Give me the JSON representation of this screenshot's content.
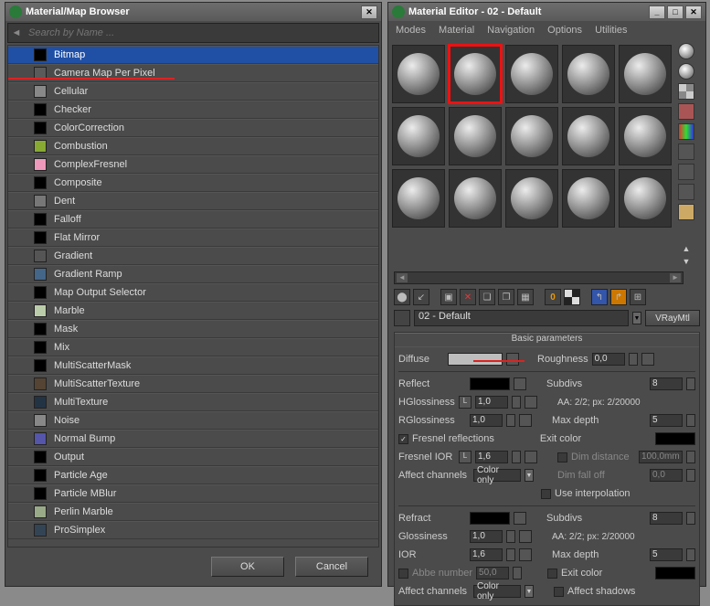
{
  "browser": {
    "title": "Material/Map Browser",
    "search_placeholder": "Search by Name ...",
    "ok": "OK",
    "cancel": "Cancel",
    "maps": [
      {
        "label": "Bitmap",
        "color": "#000",
        "sel": true
      },
      {
        "label": "Camera Map Per Pixel",
        "color": "#5a5a5a"
      },
      {
        "label": "Cellular",
        "color": "#888"
      },
      {
        "label": "Checker",
        "color": "#000"
      },
      {
        "label": "ColorCorrection",
        "color": "#000"
      },
      {
        "label": "Combustion",
        "color": "#8a3"
      },
      {
        "label": "ComplexFresnel",
        "color": "#e9b"
      },
      {
        "label": "Composite",
        "color": "#000"
      },
      {
        "label": "Dent",
        "color": "#777"
      },
      {
        "label": "Falloff",
        "color": "#000"
      },
      {
        "label": "Flat Mirror",
        "color": "#000"
      },
      {
        "label": "Gradient",
        "color": "#555"
      },
      {
        "label": "Gradient Ramp",
        "color": "#468"
      },
      {
        "label": "Map Output Selector",
        "color": "#000"
      },
      {
        "label": "Marble",
        "color": "#bca"
      },
      {
        "label": "Mask",
        "color": "#000"
      },
      {
        "label": "Mix",
        "color": "#000"
      },
      {
        "label": "MultiScatterMask",
        "color": "#000"
      },
      {
        "label": "MultiScatterTexture",
        "color": "#543"
      },
      {
        "label": "MultiTexture",
        "color": "#234"
      },
      {
        "label": "Noise",
        "color": "#888"
      },
      {
        "label": "Normal Bump",
        "color": "#55a"
      },
      {
        "label": "Output",
        "color": "#000"
      },
      {
        "label": "Particle Age",
        "color": "#000"
      },
      {
        "label": "Particle MBlur",
        "color": "#000"
      },
      {
        "label": "Perlin Marble",
        "color": "#9a8"
      },
      {
        "label": "ProSimplex",
        "color": "#345"
      }
    ]
  },
  "editor": {
    "title": "Material Editor - 02 - Default",
    "menu": [
      "Modes",
      "Material",
      "Navigation",
      "Options",
      "Utilities"
    ],
    "mat_name": "02 - Default",
    "mat_type": "VRayMtl",
    "basic_header": "Basic parameters",
    "params": {
      "diffuse_label": "Diffuse",
      "roughness_label": "Roughness",
      "roughness_val": "0,0",
      "reflect_label": "Reflect",
      "subdivs_label": "Subdivs",
      "subdivs_val": "8",
      "hgloss_label": "HGlossiness",
      "hgloss_val": "1,0",
      "aa_label": "AA: 2/2; px: 2/20000",
      "rgloss_label": "RGlossiness",
      "rgloss_val": "1,0",
      "maxdepth_label": "Max depth",
      "maxdepth_val": "5",
      "fresnel_cb": "Fresnel reflections",
      "exitcolor_label": "Exit color",
      "fresnelior_label": "Fresnel IOR",
      "fresnelior_val": "1,6",
      "dimdist_label": "Dim distance",
      "dimdist_val": "100,0mm",
      "affectch_label": "Affect channels",
      "coloronly": "Color only",
      "dimfall_label": "Dim fall off",
      "dimfall_val": "0,0",
      "interp_label": "Use interpolation",
      "refract_label": "Refract",
      "refr_subdivs": "8",
      "glossiness_label": "Glossiness",
      "glossiness_val": "1,0",
      "aa2_label": "AA: 2/2; px: 2/20000",
      "ior_label": "IOR",
      "ior_val": "1,6",
      "maxdepth2_val": "5",
      "abbe_label": "Abbe number",
      "abbe_val": "50,0",
      "exitcolor2": "Exit color",
      "affectshadows": "Affect shadows",
      "affectch2": "Affect channels"
    }
  }
}
